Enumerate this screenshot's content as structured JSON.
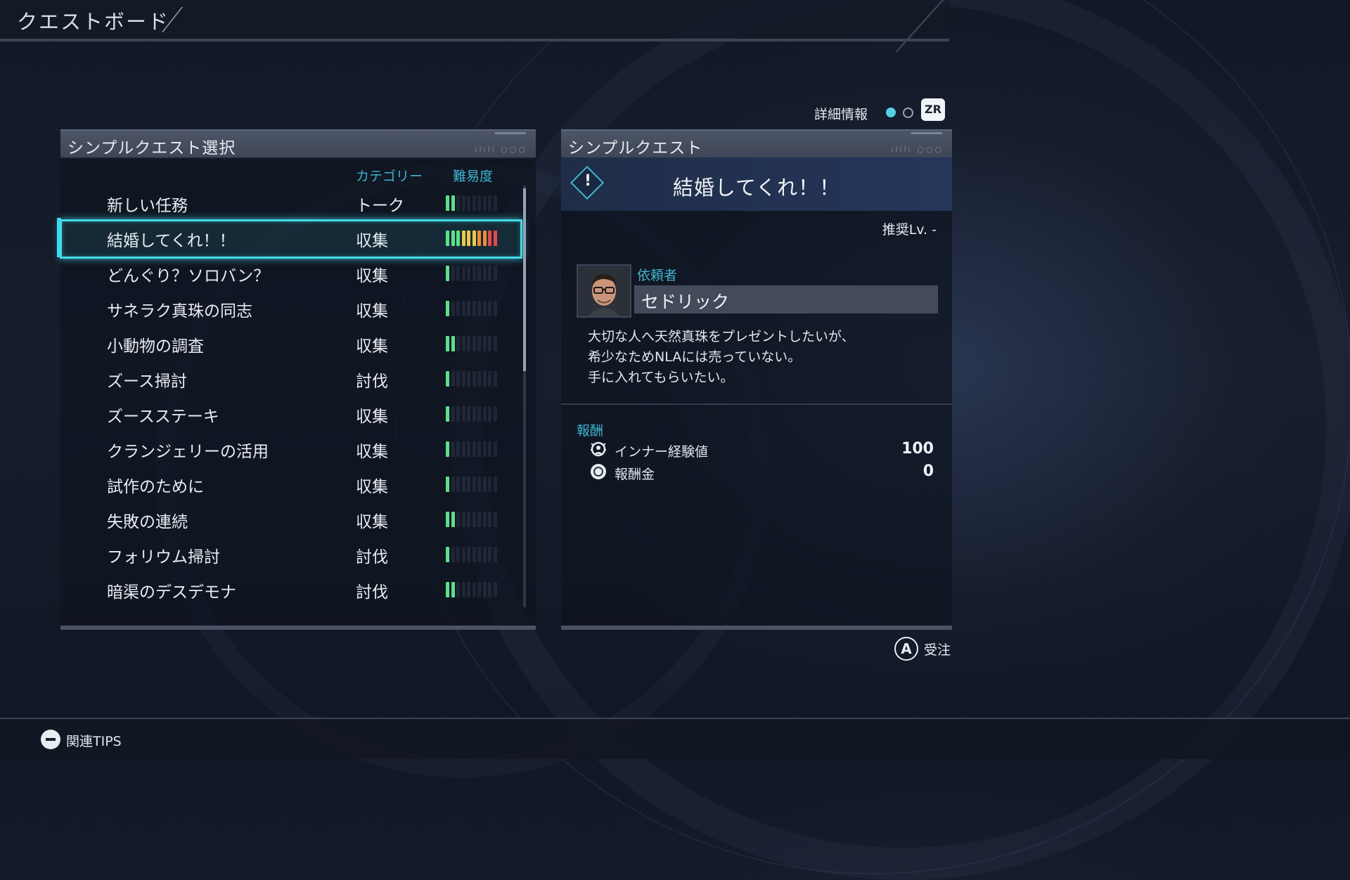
{
  "header": {
    "title": "クエストボード"
  },
  "detail_toggle": {
    "label": "詳細情報",
    "button": "ZR"
  },
  "left_panel": {
    "title": "シンプルクエスト選択",
    "col_category": "カテゴリー",
    "col_difficulty": "難易度",
    "rows": [
      {
        "name": "新しい任務",
        "category": "トーク",
        "difficulty": 2
      },
      {
        "name": "結婚してくれ！！",
        "category": "収集",
        "difficulty": 10,
        "selected": true
      },
      {
        "name": "どんぐり？ソロバン？",
        "category": "収集",
        "difficulty": 1
      },
      {
        "name": "サネラク真珠の同志",
        "category": "収集",
        "difficulty": 1
      },
      {
        "name": "小動物の調査",
        "category": "収集",
        "difficulty": 2
      },
      {
        "name": "ズース掃討",
        "category": "討伐",
        "difficulty": 1
      },
      {
        "name": "ズースステーキ",
        "category": "収集",
        "difficulty": 1
      },
      {
        "name": "クランジェリーの活用",
        "category": "収集",
        "difficulty": 1
      },
      {
        "name": "試作のために",
        "category": "収集",
        "difficulty": 1
      },
      {
        "name": "失敗の連続",
        "category": "収集",
        "difficulty": 2
      },
      {
        "name": "フォリウム掃討",
        "category": "討伐",
        "difficulty": 1
      },
      {
        "name": "暗渠のデスデモナ",
        "category": "討伐",
        "difficulty": 2
      }
    ]
  },
  "right_panel": {
    "title": "シンプルクエスト",
    "quest_title": "結婚してくれ！！",
    "recommended_level": "推奨Lv. -",
    "client_label": "依頼者",
    "client_name": "セドリック",
    "description": [
      "大切な人へ天然真珠をプレゼントしたいが、",
      "希少なためNLAには売っていない。",
      "手に入れてもらいたい。"
    ],
    "reward_label": "報酬",
    "rewards": [
      {
        "label": "インナー経験値",
        "value": "100",
        "icon": "inner-exp-icon"
      },
      {
        "label": "報酬金",
        "value": "0",
        "icon": "coin-icon"
      }
    ]
  },
  "accept": {
    "button": "A",
    "label": "受注"
  },
  "footer": {
    "tips_label": "関連TIPS"
  },
  "colors": {
    "accent": "#43d9ea",
    "label_cyan": "#3fb4cf",
    "diff_green": "#5be08a",
    "diff_yellow": "#e8c84a",
    "diff_orange": "#ee8a3a",
    "diff_red": "#e24a4a"
  }
}
